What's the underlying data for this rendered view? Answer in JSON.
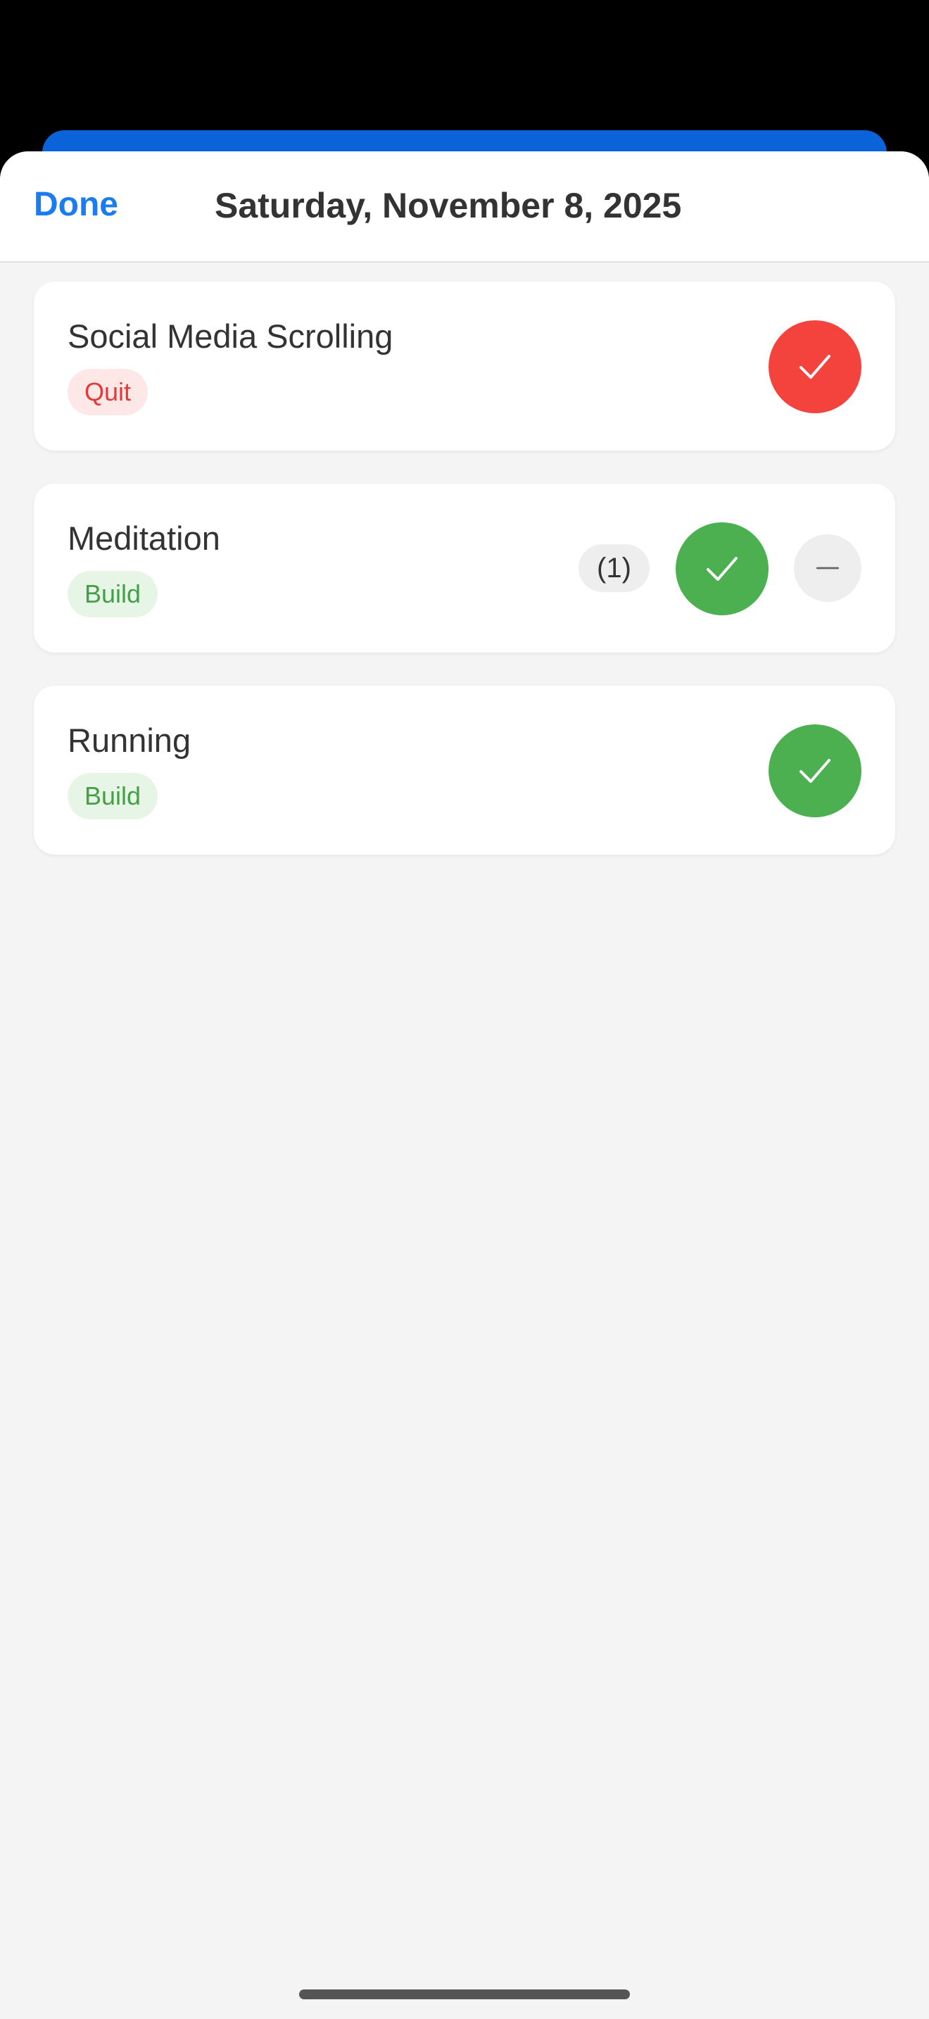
{
  "header": {
    "done_label": "Done",
    "title": "Saturday, November 8, 2025"
  },
  "habits": [
    {
      "name": "Social Media Scrolling",
      "type": "Quit",
      "completed": true,
      "accent_color": "#F4433C"
    },
    {
      "name": "Meditation",
      "type": "Build",
      "count": "(1)",
      "completed": true,
      "accent_color": "#4CAF50"
    },
    {
      "name": "Running",
      "type": "Build",
      "completed": true,
      "accent_color": "#4CAF50"
    }
  ],
  "colors": {
    "link": "#1A7CF0",
    "quit": "#F4433C",
    "build": "#4CAF50",
    "underlay": "#0A63D8"
  },
  "icons": {
    "check": "checkmark-icon",
    "minus": "minus-icon"
  }
}
